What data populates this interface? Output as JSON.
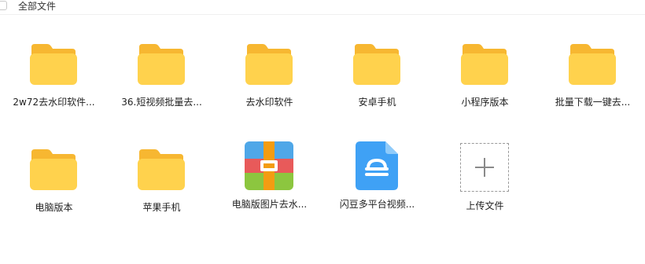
{
  "breadcrumb": {
    "label": "全部文件"
  },
  "items": [
    {
      "name": "2w72去水印软件...",
      "type": "folder"
    },
    {
      "name": "36.短视频批量去...",
      "type": "folder"
    },
    {
      "name": "去水印软件",
      "type": "folder"
    },
    {
      "name": "安卓手机",
      "type": "folder"
    },
    {
      "name": "小程序版本",
      "type": "folder"
    },
    {
      "name": "批量下载一键去...",
      "type": "folder"
    },
    {
      "name": "电脑版本",
      "type": "folder"
    },
    {
      "name": "苹果手机",
      "type": "folder"
    },
    {
      "name": "电脑版图片去水...",
      "type": "archive"
    },
    {
      "name": "闪豆多平台视频...",
      "type": "app-file"
    }
  ],
  "upload": {
    "label": "上传文件"
  },
  "colors": {
    "folder_back": "#F7B731",
    "folder_front": "#FFD24D",
    "archive_red": "#E85A5A",
    "archive_green": "#8CC63F",
    "archive_orange": "#F39C12",
    "file_blue": "#3FA1F5"
  }
}
